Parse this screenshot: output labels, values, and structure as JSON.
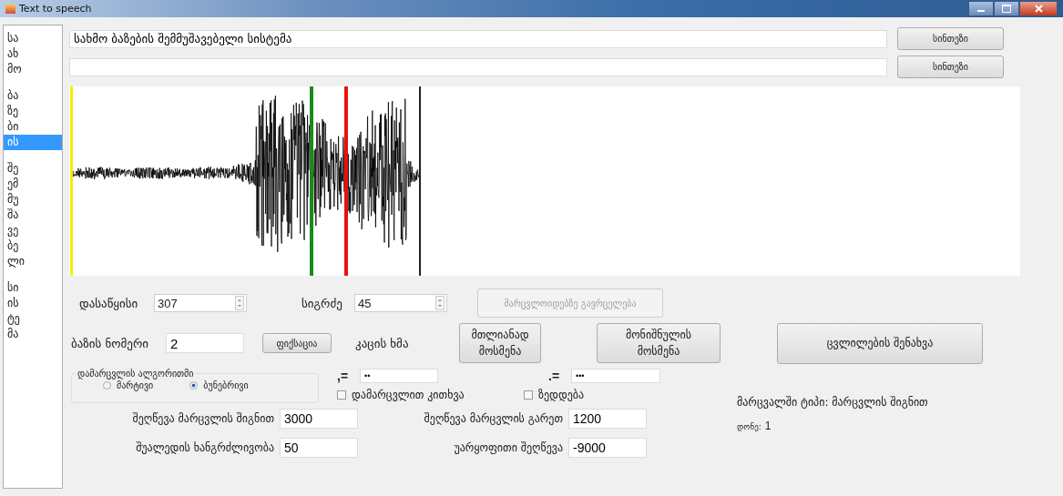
{
  "window": {
    "title": "Text to speech"
  },
  "syllable_list": [
    {
      "items": [
        {
          "text": "სა",
          "selected": false
        },
        {
          "text": "ახ",
          "selected": false
        },
        {
          "text": "მო",
          "selected": false
        }
      ]
    },
    {
      "items": [
        {
          "text": "ბა",
          "selected": false
        },
        {
          "text": "ზე",
          "selected": false
        },
        {
          "text": "ბი",
          "selected": false
        },
        {
          "text": "ის",
          "selected": true
        }
      ]
    },
    {
      "items": [
        {
          "text": "შე",
          "selected": false
        },
        {
          "text": "ემ",
          "selected": false
        },
        {
          "text": "მუ",
          "selected": false
        },
        {
          "text": "შა",
          "selected": false
        },
        {
          "text": "ვე",
          "selected": false
        },
        {
          "text": "ბე",
          "selected": false
        },
        {
          "text": "ლი",
          "selected": false
        }
      ]
    },
    {
      "items": [
        {
          "text": "სი",
          "selected": false
        },
        {
          "text": "ის",
          "selected": false
        },
        {
          "text": "ტე",
          "selected": false
        },
        {
          "text": "მა",
          "selected": false
        }
      ]
    }
  ],
  "text_inputs": [
    {
      "value": "სახმო ბაზების შემმუშავებელი სისტემა",
      "button": "სინთეზი"
    },
    {
      "button": "სინთეზი"
    }
  ],
  "start": {
    "label": "დასაწყისი",
    "value": "307"
  },
  "length": {
    "label": "სიგრძე",
    "value": "45"
  },
  "spread_button": {
    "label": "მარცვლოიდებზე გავრცელება",
    "disabled": true
  },
  "base_number": {
    "label": "ბაზის ნომერი",
    "value": "2"
  },
  "fix_button": "ფიქსაცია",
  "voice_label": "კაცის ხმა",
  "listen_all_button": "მთლიანად მოსმენა",
  "listen_selected_button": "მონიშნულის მოსმენა",
  "save_button": "ცვლილების შენახვა",
  "algorithm": {
    "title": "დამარცვლის ალგორითმი",
    "options": [
      {
        "label": "მარტივი",
        "selected": false
      },
      {
        "label": "ბუნებრივი",
        "selected": true
      }
    ]
  },
  "separators": [
    {
      "label": ",=",
      "value": "••"
    },
    {
      "label": ".=",
      "value": "•••"
    }
  ],
  "checkboxes": [
    {
      "label": "დამარცვლით კითხვა",
      "checked": false
    },
    {
      "label": "ზედდება",
      "checked": false
    }
  ],
  "params": [
    {
      "label": "შეღწევა მარცვლის შიგნით",
      "value": "3000"
    },
    {
      "label": "შეღწევა მარცვლის გარეთ",
      "value": "1200"
    },
    {
      "label": "შუალედის ხანგრძლივობა",
      "value": "50"
    },
    {
      "label": "უარყოფითი შეღწევა",
      "value": "-9000"
    }
  ],
  "syllable_type": "მარცვალში ტიპი: მარცვლის შიგნით",
  "level": {
    "label": "დონე:",
    "value": "1"
  }
}
